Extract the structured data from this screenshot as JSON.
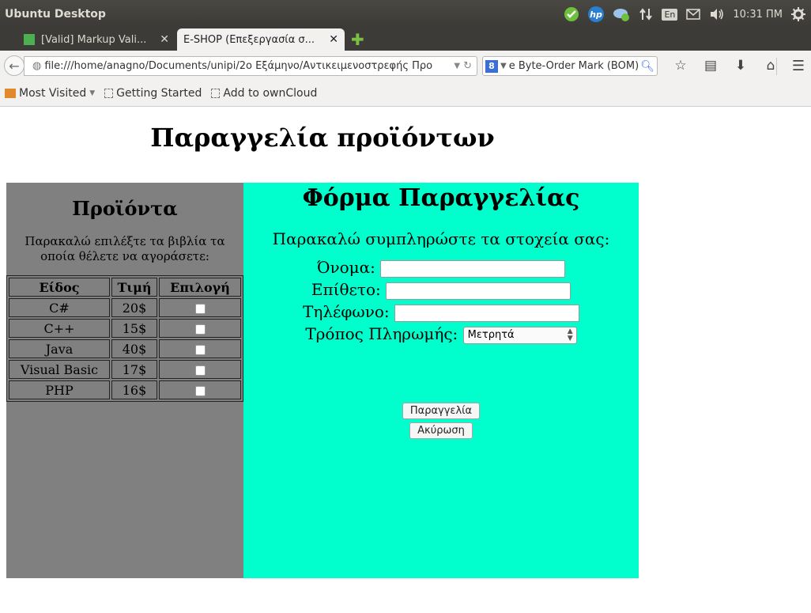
{
  "os_panel": {
    "title": "Ubuntu Desktop",
    "keyboard_layout": "En",
    "clock": "10:31 ΠΜ",
    "icons": [
      "shield-check-icon",
      "hp-icon",
      "network-icon",
      "transfer-icon",
      "keyboard-icon",
      "mail-icon",
      "volume-icon",
      "gear-icon"
    ]
  },
  "tabs": [
    {
      "label": "[Valid] Markup Vali...",
      "active": false
    },
    {
      "label": "E-SHOP (Επεξεργασία σ...",
      "active": true
    }
  ],
  "navbar": {
    "url": "file:///home/anagno/Documents/unipi/2ο Εξάμηνο/Αντικειμενοστρεφής Προ",
    "search_engine": "8",
    "search_text": "e Byte-Order Mark (BOM)"
  },
  "bookmarks": {
    "most_visited": "Most Visited",
    "getting_started": "Getting Started",
    "add_owncloud": "Add to ownCloud"
  },
  "page": {
    "title": "Παραγγελία προϊόντων",
    "products": {
      "heading": "Προϊόντα",
      "instruction": "Παρακαλώ επιλέξτε τα βιβλία τα οποία θέλετε να αγοράσετε:",
      "columns": [
        "Είδος",
        "Τιμή",
        "Επιλογή"
      ],
      "rows": [
        {
          "name": "C#",
          "price": "20$",
          "checked": false
        },
        {
          "name": "C++",
          "price": "15$",
          "checked": false
        },
        {
          "name": "Java",
          "price": "40$",
          "checked": false
        },
        {
          "name": "Visual Basic",
          "price": "17$",
          "checked": false
        },
        {
          "name": "PHP",
          "price": "16$",
          "checked": false
        }
      ]
    },
    "order_form": {
      "heading": "Φόρμα Παραγγελίας",
      "instruction": "Παρακαλώ συμπληρώστε τα στοχεία σας:",
      "first_name_label": "Όνομα:",
      "first_name_value": "",
      "last_name_label": "Επίθετο:",
      "last_name_value": "",
      "phone_label": "Τηλέφωνο:",
      "phone_value": "",
      "payment_label": "Τρόπος Πληρωμής:",
      "payment_selected": "Μετρητά",
      "submit_label": "Παραγγελία",
      "cancel_label": "Ακύρωση"
    },
    "colors": {
      "products_bg": "#808080",
      "order_bg": "#00ffcc"
    }
  }
}
